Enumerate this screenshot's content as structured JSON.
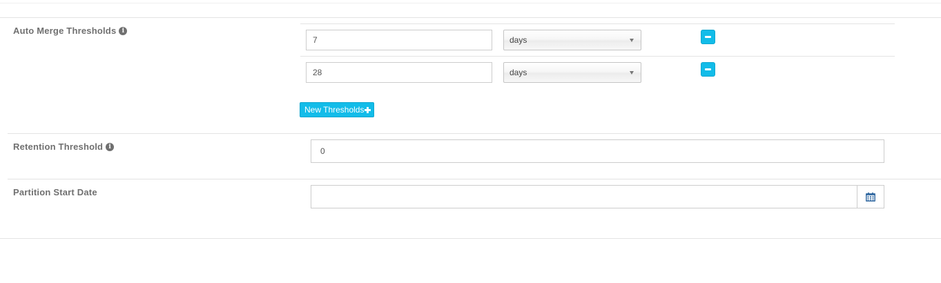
{
  "auto_merge": {
    "label": "Auto Merge Thresholds",
    "info_icon": "info-icon",
    "rows": [
      {
        "value": "7",
        "unit": "days"
      },
      {
        "value": "28",
        "unit": "days"
      }
    ],
    "remove_icon": "minus-icon",
    "new_button_label": "New Thresholds",
    "new_button_icon": "plus-icon"
  },
  "retention": {
    "label": "Retention Threshold",
    "info_icon": "info-icon",
    "value": "0"
  },
  "partition": {
    "label": "Partition Start Date",
    "value": "",
    "calendar_icon": "calendar-icon"
  },
  "colors": {
    "accent": "#12bce9",
    "label_text": "#707070",
    "divider": "#e3e3e3"
  }
}
